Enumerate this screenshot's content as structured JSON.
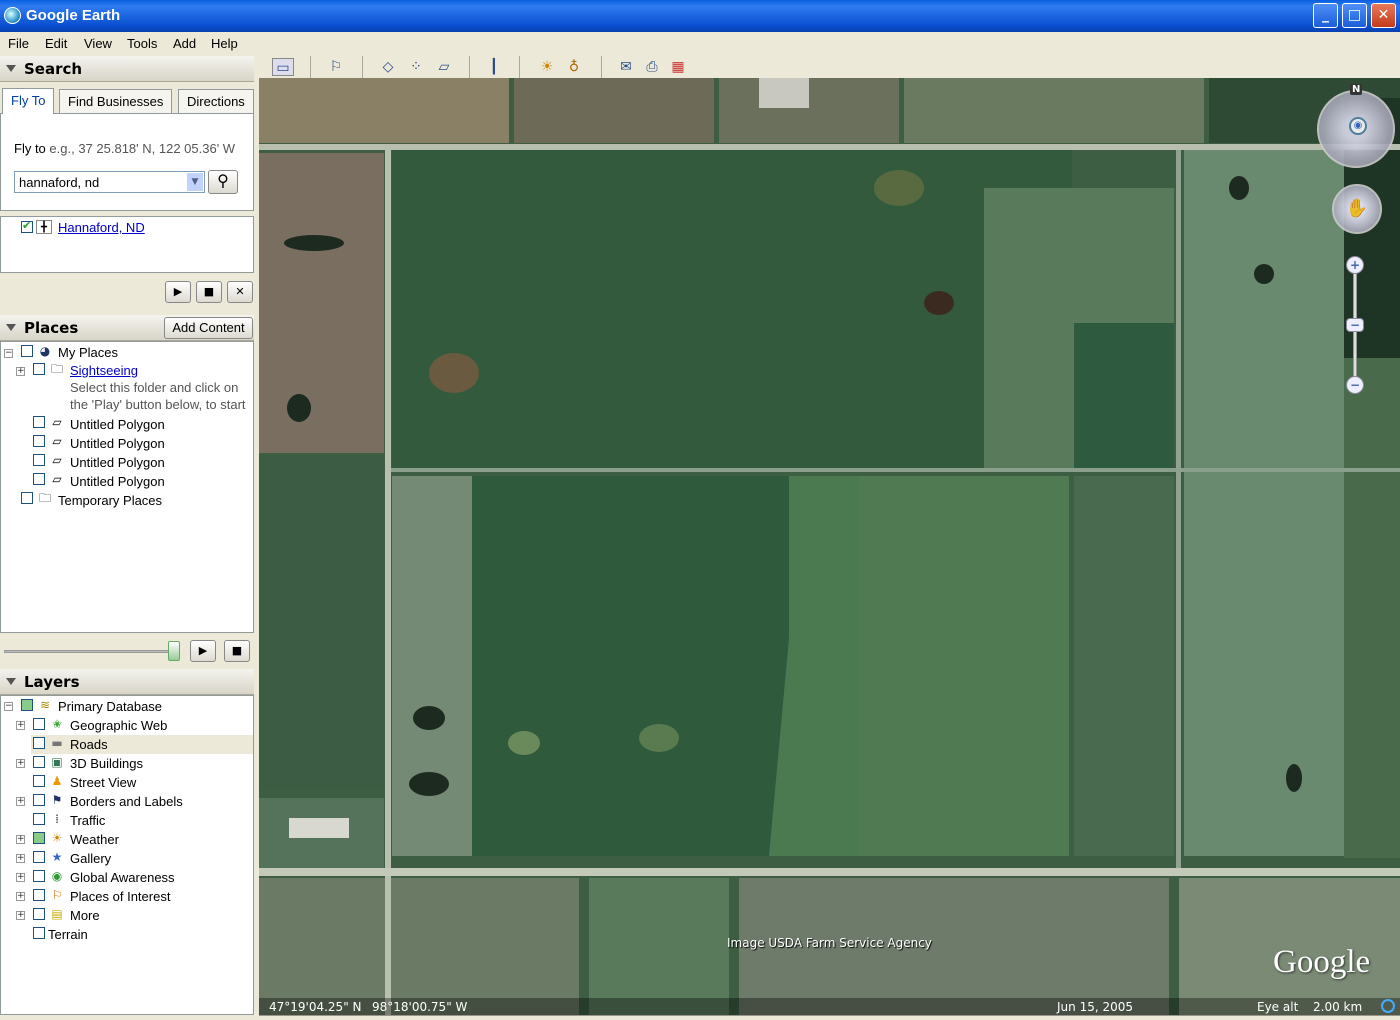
{
  "window": {
    "title": "Google Earth",
    "minimize": "_",
    "maximize": "□",
    "close": "✕"
  },
  "menu": [
    "File",
    "Edit",
    "View",
    "Tools",
    "Add",
    "Help"
  ],
  "search": {
    "title": "Search",
    "tabs": [
      "Fly To",
      "Find Businesses",
      "Directions"
    ],
    "fly_to_label": "Fly to",
    "fly_to_example": "e.g., 37 25.818' N, 122 05.36' W",
    "input_value": "hannaford, nd",
    "result": "Hannaford, ND"
  },
  "places": {
    "title": "Places",
    "add_content": "Add Content",
    "items": [
      {
        "label": "My Places"
      },
      {
        "label": "Sightseeing"
      },
      {
        "label": "Select this folder and click on"
      },
      {
        "label": "the 'Play' button below, to start"
      },
      {
        "label": "Untitled Polygon"
      },
      {
        "label": "Untitled Polygon"
      },
      {
        "label": "Untitled Polygon"
      },
      {
        "label": "Untitled Polygon"
      },
      {
        "label": "Temporary Places"
      }
    ]
  },
  "layers": {
    "title": "Layers",
    "items": [
      {
        "label": "Primary Database"
      },
      {
        "label": "Geographic Web"
      },
      {
        "label": "Roads"
      },
      {
        "label": "3D Buildings"
      },
      {
        "label": "Street View"
      },
      {
        "label": "Borders and Labels"
      },
      {
        "label": "Traffic"
      },
      {
        "label": "Weather"
      },
      {
        "label": "Gallery"
      },
      {
        "label": "Global Awareness"
      },
      {
        "label": "Places of Interest"
      },
      {
        "label": "More"
      },
      {
        "label": "Terrain"
      }
    ]
  },
  "map": {
    "attribution": "Image USDA Farm Service Agency",
    "logo": "Google",
    "lat": "47°19'04.25\" N",
    "lon": "98°18'00.75\" W",
    "date": "Jun 15, 2005",
    "eye_alt_label": "Eye alt",
    "eye_alt_value": "2.00 km",
    "compass_n": "N"
  },
  "icons": {
    "play": "▶",
    "stop": "■",
    "close": "✕",
    "search": "⚲",
    "dropdown": "▼",
    "zoom_in": "+",
    "zoom_out": "−"
  }
}
